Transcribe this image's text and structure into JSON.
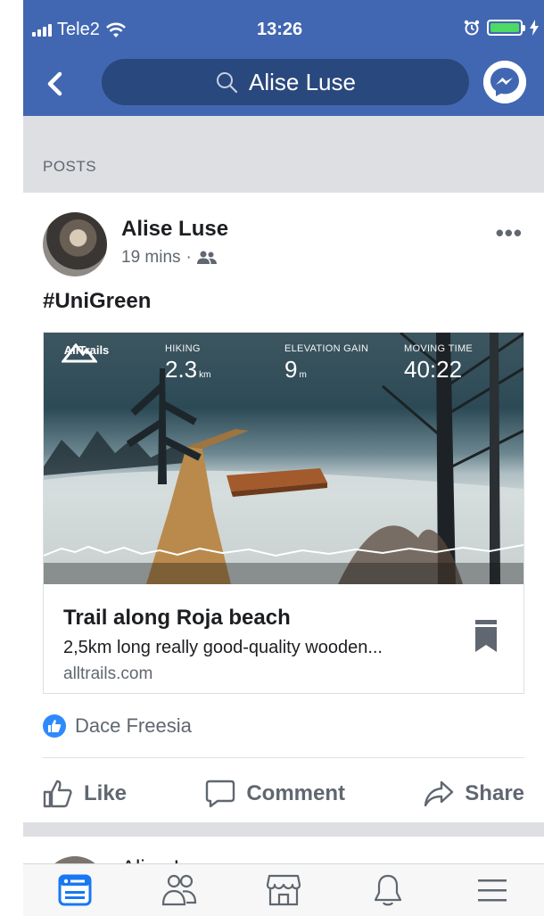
{
  "status_bar": {
    "carrier": "Tele2",
    "time": "13:26"
  },
  "header": {
    "search_query": "Alise Luse"
  },
  "section": {
    "label": "POSTS"
  },
  "post": {
    "author": "Alise Luse",
    "time": "19 mins",
    "separator": "·",
    "privacy_icon": "friends-icon",
    "caption": "#UniGreen",
    "card": {
      "logo_text": "AllTrails",
      "stats": [
        {
          "label": "HIKING",
          "value": "2.3",
          "unit": "km"
        },
        {
          "label": "ELEVATION GAIN",
          "value": "9",
          "unit": "m"
        },
        {
          "label": "MOVING TIME",
          "value": "40:22",
          "unit": ""
        }
      ],
      "title": "Trail along Roja beach",
      "description": "2,5km long really good-quality wooden...",
      "domain": "alltrails.com"
    },
    "reactions": {
      "liker": "Dace Freesia"
    },
    "actions": {
      "like": "Like",
      "comment": "Comment",
      "share": "Share"
    }
  },
  "next_post": {
    "author_partial": "Alise Luse"
  },
  "colors": {
    "brand_blue": "#4267b2",
    "like_blue": "#2e89ff",
    "muted": "#606770"
  },
  "tabbar": [
    "news-feed-icon",
    "friends-icon",
    "marketplace-icon",
    "notifications-icon",
    "menu-icon"
  ]
}
